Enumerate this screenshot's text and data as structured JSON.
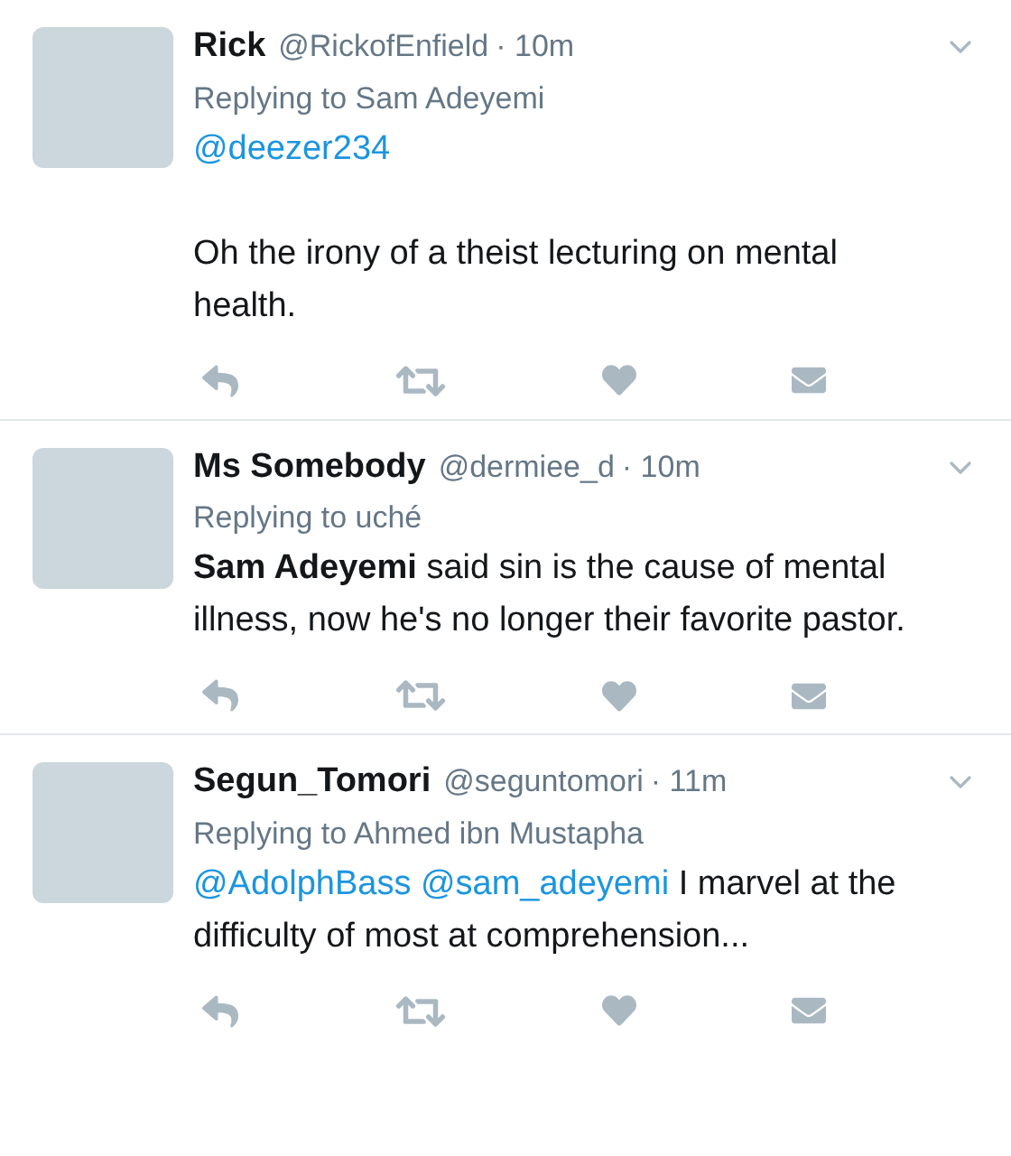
{
  "tweets": [
    {
      "name": "Rick",
      "handle": "@RickofEnfield",
      "time": "· 10m",
      "replying_to": "Replying to Sam Adeyemi",
      "body": [
        {
          "parts": [
            {
              "kind": "mention",
              "text": "@deezer234"
            }
          ]
        },
        {
          "parts": [
            {
              "kind": "text",
              "text": "Oh the irony of a theist lecturing on mental health."
            }
          ]
        }
      ]
    },
    {
      "name": "Ms Somebody",
      "handle": "@dermiee_d",
      "time": "· 10m",
      "replying_to": "Replying to uché",
      "body": [
        {
          "parts": [
            {
              "kind": "text",
              "text": "**Sam Adeyemi** said sin is the cause of mental illness, now he's no longer their favorite pastor."
            }
          ]
        }
      ]
    },
    {
      "name": "Segun_Tomori",
      "handle": "@seguntomori",
      "time": "· 11m",
      "replying_to": "Replying to Ahmed ibn Mustapha",
      "body": [
        {
          "parts": [
            {
              "kind": "mention",
              "text": "@AdolphBass"
            },
            {
              "kind": "mention",
              "text": "@sam_adeyemi"
            },
            {
              "kind": "text",
              "text": "I marvel at the difficulty of most at comprehension..."
            }
          ]
        }
      ]
    }
  ]
}
